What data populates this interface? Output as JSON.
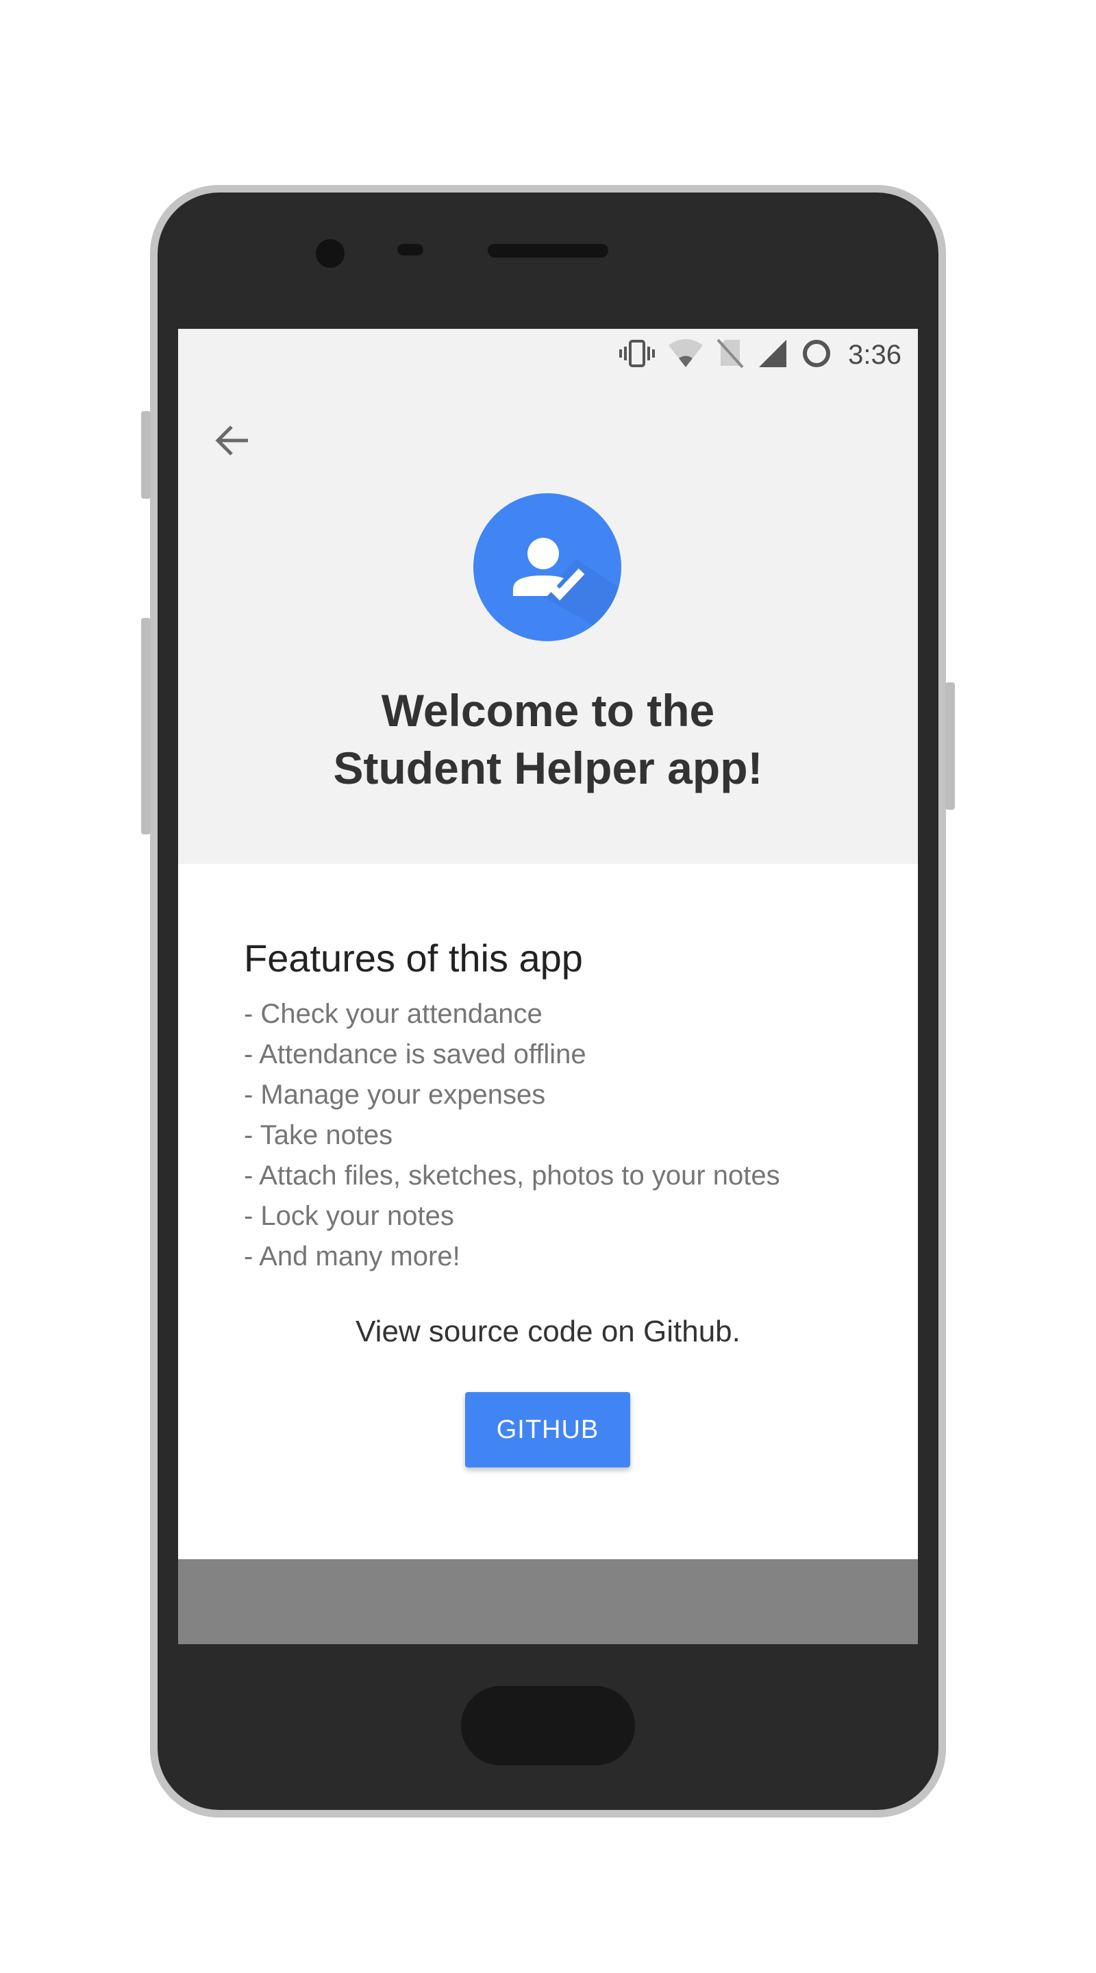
{
  "status_bar": {
    "time": "3:36",
    "icons": [
      "vibrate-icon",
      "wifi-off-icon",
      "no-sim-icon",
      "signal-icon",
      "circle-icon"
    ]
  },
  "header": {
    "back_icon": "arrow-back-icon",
    "logo_icon": "person-check-icon",
    "title": "Welcome to the\nStudent Helper app!"
  },
  "features": {
    "heading": "Features of this app",
    "items": [
      "- Check your attendance",
      "- Attendance is saved offline",
      "- Manage your expenses",
      "- Take notes",
      "- Attach files, sketches, photos to your notes",
      "- Lock your notes",
      "- And many more!"
    ]
  },
  "source": {
    "text": "View source code on Github.",
    "button_label": "GITHUB"
  },
  "colors": {
    "accent": "#4185f4",
    "header_bg": "#f2f2f2",
    "bottom_bar": "#838383",
    "phone_body": "#2a2a2a"
  }
}
